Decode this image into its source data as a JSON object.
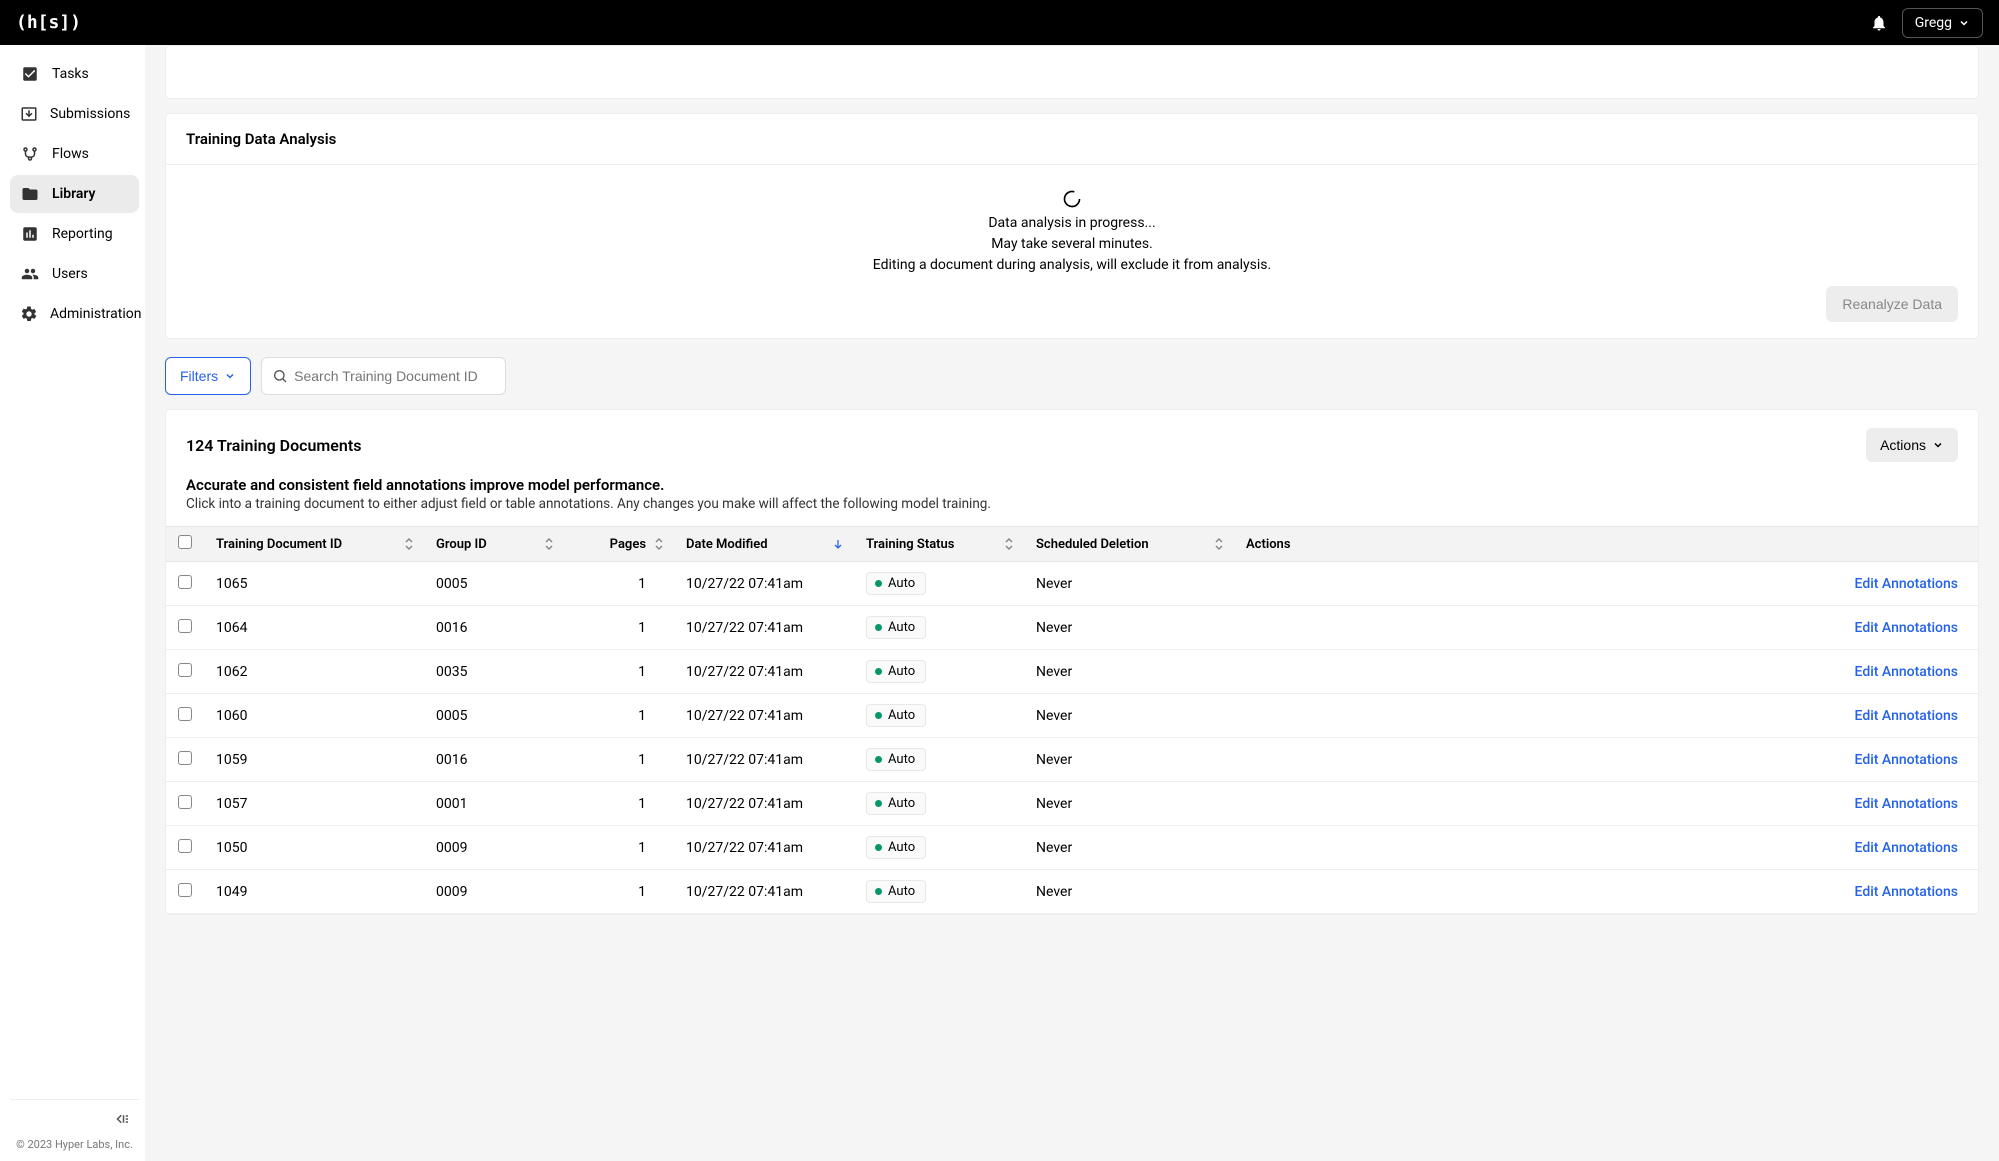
{
  "topbar": {
    "logo": "(h[s])",
    "username": "Gregg"
  },
  "sidebar": {
    "items": [
      {
        "label": "Tasks",
        "icon": "tasks"
      },
      {
        "label": "Submissions",
        "icon": "submissions"
      },
      {
        "label": "Flows",
        "icon": "flows"
      },
      {
        "label": "Library",
        "icon": "library",
        "active": true
      },
      {
        "label": "Reporting",
        "icon": "reporting"
      },
      {
        "label": "Users",
        "icon": "users"
      },
      {
        "label": "Administration",
        "icon": "administration"
      }
    ],
    "copyright": "© 2023 Hyper Labs, Inc."
  },
  "analysis": {
    "title": "Training Data Analysis",
    "line1": "Data analysis in progress...",
    "line2": "May take several minutes.",
    "line3": "Editing a document during analysis, will exclude it from analysis.",
    "reanalyze_label": "Reanalyze Data"
  },
  "filters": {
    "button_label": "Filters",
    "search_placeholder": "Search Training Document ID"
  },
  "documents": {
    "count_label": "124 Training Documents",
    "actions_label": "Actions",
    "info_title": "Accurate and consistent field annotations improve model performance.",
    "info_sub": "Click into a training document to either adjust field or table annotations. Any changes you make will affect the following model training.",
    "columns": {
      "doc_id": "Training Document ID",
      "group_id": "Group ID",
      "pages": "Pages",
      "date_modified": "Date Modified",
      "training_status": "Training Status",
      "scheduled_deletion": "Scheduled Deletion",
      "actions": "Actions"
    },
    "action_link": "Edit Annotations",
    "rows": [
      {
        "doc_id": "1065",
        "group_id": "0005",
        "pages": "1",
        "date_modified": "10/27/22 07:41am",
        "status": "Auto",
        "deletion": "Never"
      },
      {
        "doc_id": "1064",
        "group_id": "0016",
        "pages": "1",
        "date_modified": "10/27/22 07:41am",
        "status": "Auto",
        "deletion": "Never"
      },
      {
        "doc_id": "1062",
        "group_id": "0035",
        "pages": "1",
        "date_modified": "10/27/22 07:41am",
        "status": "Auto",
        "deletion": "Never"
      },
      {
        "doc_id": "1060",
        "group_id": "0005",
        "pages": "1",
        "date_modified": "10/27/22 07:41am",
        "status": "Auto",
        "deletion": "Never"
      },
      {
        "doc_id": "1059",
        "group_id": "0016",
        "pages": "1",
        "date_modified": "10/27/22 07:41am",
        "status": "Auto",
        "deletion": "Never"
      },
      {
        "doc_id": "1057",
        "group_id": "0001",
        "pages": "1",
        "date_modified": "10/27/22 07:41am",
        "status": "Auto",
        "deletion": "Never"
      },
      {
        "doc_id": "1050",
        "group_id": "0009",
        "pages": "1",
        "date_modified": "10/27/22 07:41am",
        "status": "Auto",
        "deletion": "Never"
      },
      {
        "doc_id": "1049",
        "group_id": "0009",
        "pages": "1",
        "date_modified": "10/27/22 07:41am",
        "status": "Auto",
        "deletion": "Never"
      }
    ]
  }
}
